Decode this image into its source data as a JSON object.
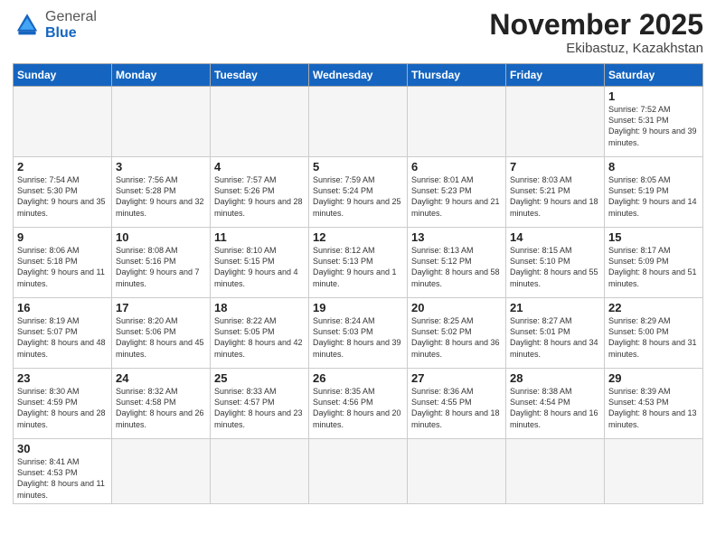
{
  "logo": {
    "general": "General",
    "blue": "Blue"
  },
  "title": "November 2025",
  "location": "Ekibastuz, Kazakhstan",
  "days_header": [
    "Sunday",
    "Monday",
    "Tuesday",
    "Wednesday",
    "Thursday",
    "Friday",
    "Saturday"
  ],
  "weeks": [
    [
      {
        "num": "",
        "info": ""
      },
      {
        "num": "",
        "info": ""
      },
      {
        "num": "",
        "info": ""
      },
      {
        "num": "",
        "info": ""
      },
      {
        "num": "",
        "info": ""
      },
      {
        "num": "",
        "info": ""
      },
      {
        "num": "1",
        "info": "Sunrise: 7:52 AM\nSunset: 5:31 PM\nDaylight: 9 hours\nand 39 minutes."
      }
    ],
    [
      {
        "num": "2",
        "info": "Sunrise: 7:54 AM\nSunset: 5:30 PM\nDaylight: 9 hours\nand 35 minutes."
      },
      {
        "num": "3",
        "info": "Sunrise: 7:56 AM\nSunset: 5:28 PM\nDaylight: 9 hours\nand 32 minutes."
      },
      {
        "num": "4",
        "info": "Sunrise: 7:57 AM\nSunset: 5:26 PM\nDaylight: 9 hours\nand 28 minutes."
      },
      {
        "num": "5",
        "info": "Sunrise: 7:59 AM\nSunset: 5:24 PM\nDaylight: 9 hours\nand 25 minutes."
      },
      {
        "num": "6",
        "info": "Sunrise: 8:01 AM\nSunset: 5:23 PM\nDaylight: 9 hours\nand 21 minutes."
      },
      {
        "num": "7",
        "info": "Sunrise: 8:03 AM\nSunset: 5:21 PM\nDaylight: 9 hours\nand 18 minutes."
      },
      {
        "num": "8",
        "info": "Sunrise: 8:05 AM\nSunset: 5:19 PM\nDaylight: 9 hours\nand 14 minutes."
      }
    ],
    [
      {
        "num": "9",
        "info": "Sunrise: 8:06 AM\nSunset: 5:18 PM\nDaylight: 9 hours\nand 11 minutes."
      },
      {
        "num": "10",
        "info": "Sunrise: 8:08 AM\nSunset: 5:16 PM\nDaylight: 9 hours\nand 7 minutes."
      },
      {
        "num": "11",
        "info": "Sunrise: 8:10 AM\nSunset: 5:15 PM\nDaylight: 9 hours\nand 4 minutes."
      },
      {
        "num": "12",
        "info": "Sunrise: 8:12 AM\nSunset: 5:13 PM\nDaylight: 9 hours\nand 1 minute."
      },
      {
        "num": "13",
        "info": "Sunrise: 8:13 AM\nSunset: 5:12 PM\nDaylight: 8 hours\nand 58 minutes."
      },
      {
        "num": "14",
        "info": "Sunrise: 8:15 AM\nSunset: 5:10 PM\nDaylight: 8 hours\nand 55 minutes."
      },
      {
        "num": "15",
        "info": "Sunrise: 8:17 AM\nSunset: 5:09 PM\nDaylight: 8 hours\nand 51 minutes."
      }
    ],
    [
      {
        "num": "16",
        "info": "Sunrise: 8:19 AM\nSunset: 5:07 PM\nDaylight: 8 hours\nand 48 minutes."
      },
      {
        "num": "17",
        "info": "Sunrise: 8:20 AM\nSunset: 5:06 PM\nDaylight: 8 hours\nand 45 minutes."
      },
      {
        "num": "18",
        "info": "Sunrise: 8:22 AM\nSunset: 5:05 PM\nDaylight: 8 hours\nand 42 minutes."
      },
      {
        "num": "19",
        "info": "Sunrise: 8:24 AM\nSunset: 5:03 PM\nDaylight: 8 hours\nand 39 minutes."
      },
      {
        "num": "20",
        "info": "Sunrise: 8:25 AM\nSunset: 5:02 PM\nDaylight: 8 hours\nand 36 minutes."
      },
      {
        "num": "21",
        "info": "Sunrise: 8:27 AM\nSunset: 5:01 PM\nDaylight: 8 hours\nand 34 minutes."
      },
      {
        "num": "22",
        "info": "Sunrise: 8:29 AM\nSunset: 5:00 PM\nDaylight: 8 hours\nand 31 minutes."
      }
    ],
    [
      {
        "num": "23",
        "info": "Sunrise: 8:30 AM\nSunset: 4:59 PM\nDaylight: 8 hours\nand 28 minutes."
      },
      {
        "num": "24",
        "info": "Sunrise: 8:32 AM\nSunset: 4:58 PM\nDaylight: 8 hours\nand 26 minutes."
      },
      {
        "num": "25",
        "info": "Sunrise: 8:33 AM\nSunset: 4:57 PM\nDaylight: 8 hours\nand 23 minutes."
      },
      {
        "num": "26",
        "info": "Sunrise: 8:35 AM\nSunset: 4:56 PM\nDaylight: 8 hours\nand 20 minutes."
      },
      {
        "num": "27",
        "info": "Sunrise: 8:36 AM\nSunset: 4:55 PM\nDaylight: 8 hours\nand 18 minutes."
      },
      {
        "num": "28",
        "info": "Sunrise: 8:38 AM\nSunset: 4:54 PM\nDaylight: 8 hours\nand 16 minutes."
      },
      {
        "num": "29",
        "info": "Sunrise: 8:39 AM\nSunset: 4:53 PM\nDaylight: 8 hours\nand 13 minutes."
      }
    ],
    [
      {
        "num": "30",
        "info": "Sunrise: 8:41 AM\nSunset: 4:53 PM\nDaylight: 8 hours\nand 11 minutes."
      },
      {
        "num": "",
        "info": ""
      },
      {
        "num": "",
        "info": ""
      },
      {
        "num": "",
        "info": ""
      },
      {
        "num": "",
        "info": ""
      },
      {
        "num": "",
        "info": ""
      },
      {
        "num": "",
        "info": ""
      }
    ]
  ]
}
